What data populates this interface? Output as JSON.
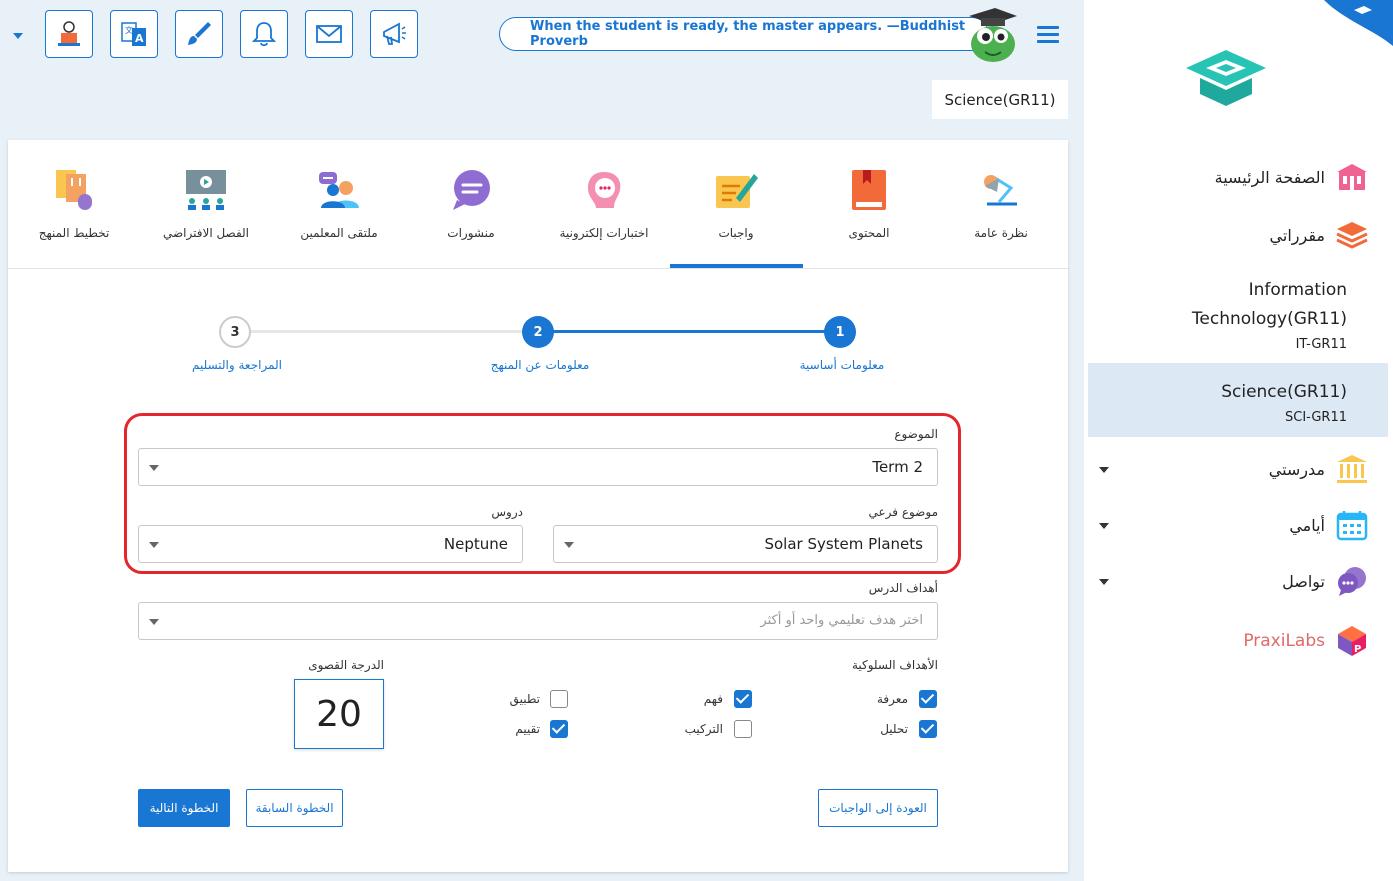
{
  "toolbar": {
    "quote": "When the student is ready, the master appears. —Buddhist Proverb",
    "icons": [
      "teacher-icon",
      "translate-icon",
      "paint-brush-icon",
      "bell-icon",
      "mail-icon",
      "megaphone-icon"
    ]
  },
  "header": {
    "course_chip": "Science(GR11)"
  },
  "tabs": [
    {
      "label": "نظرة عامة",
      "icon": "overview-icon"
    },
    {
      "label": "المحتوى",
      "icon": "book-icon"
    },
    {
      "label": "واجبات",
      "icon": "assignment-icon"
    },
    {
      "label": "اختبارات إلكترونية",
      "icon": "quiz-icon"
    },
    {
      "label": "منشورات",
      "icon": "chat-bubble-icon"
    },
    {
      "label": "ملتقى المعلمين",
      "icon": "teachers-group-icon"
    },
    {
      "label": "الفصل الافتراضي",
      "icon": "virtual-class-icon"
    },
    {
      "label": "تخطيط المنهج",
      "icon": "curriculum-plan-icon"
    }
  ],
  "stepper": {
    "steps": [
      {
        "num": "1",
        "label": "معلومات أساسية"
      },
      {
        "num": "2",
        "label": "معلومات عن المنهج"
      },
      {
        "num": "3",
        "label": "المراجعة والتسليم"
      }
    ]
  },
  "form": {
    "subject_label": "الموضوع",
    "subject_value": "Term 2",
    "subtopic_label": "موضوع فرعي",
    "subtopic_value": "Solar System Planets",
    "lessons_label": "دروس",
    "lessons_value": "Neptune",
    "objectives_label": "أهداف الدرس",
    "objectives_placeholder": "اختر هدف تعليمي واحد أو أكثر",
    "behavioral_label": "الأهداف السلوكية",
    "max_grade_label": "الدرجة القصوى",
    "max_grade_value": "20",
    "checkboxes": [
      {
        "label": "معرفة",
        "checked": true
      },
      {
        "label": "فهم",
        "checked": true
      },
      {
        "label": "تطبيق",
        "checked": false
      },
      {
        "label": "تحليل",
        "checked": true
      },
      {
        "label": "التركيب",
        "checked": false
      },
      {
        "label": "تقييم",
        "checked": true
      }
    ],
    "back_button": "العودة إلى الواجبات",
    "prev_button": "الخطوة السابقة",
    "next_button": "الخطوة التالية"
  },
  "sidebar": {
    "home": "الصفحة الرئيسية",
    "my_courses": "مقرراتي",
    "courses": [
      {
        "title_line1": "Information",
        "title_line2": "Technology(GR11)",
        "code": "IT-GR11"
      },
      {
        "title": "Science(GR11)",
        "code": "SCI-GR11"
      }
    ],
    "my_school": "مدرستي",
    "my_days": "أيامي",
    "communication": "تواصل",
    "praxilabs": "PraxiLabs"
  },
  "colors": {
    "accent": "#1976d2",
    "highlight_box": "#e3272d",
    "selected_course_bg": "#dde8f5",
    "brand_teal": "#27c4b5"
  }
}
